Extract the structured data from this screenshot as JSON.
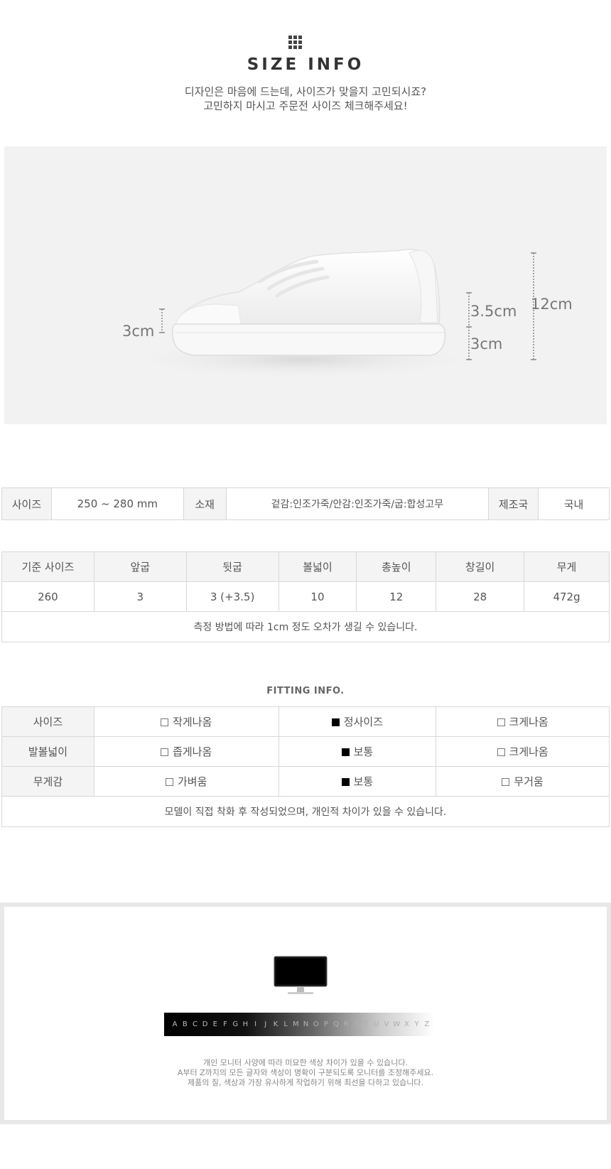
{
  "header": {
    "grid_icon": "grid-icon",
    "title": "SIZE INFO",
    "subtitle_line1": "디자인은 마음에 드는데, 사이즈가 맞을지 고민되시죠?",
    "subtitle_line2": "고민하지 마시고 주문전 사이즈 체크해주세요!"
  },
  "photo": {
    "dim_front": "3cm",
    "dim_insole": "3.5cm",
    "dim_heel": "3cm",
    "dim_total": "12cm"
  },
  "info_table": {
    "size_label": "사이즈",
    "size_value": "250 ~ 280 mm",
    "material_label": "소재",
    "material_value": "겉감:인조가죽/안감:인조가죽/굽:합성고무",
    "origin_label": "제조국",
    "origin_value": "국내"
  },
  "spec_table": {
    "headers": [
      "기준 사이즈",
      "앞굽",
      "뒷굽",
      "볼넓이",
      "총높이",
      "창길이",
      "무게"
    ],
    "values": [
      "260",
      "3",
      "3 (+3.5)",
      "10",
      "12",
      "28",
      "472g"
    ],
    "note": "측정 방법에 따라 1cm 정도 오차가 생길 수 있습니다."
  },
  "fitting": {
    "title": "FITTING INFO.",
    "rows": [
      {
        "label": "사이즈",
        "opt1": "작게나옴",
        "opt2": "정사이즈",
        "opt3": "크게나옴",
        "selected": 2
      },
      {
        "label": "발볼넓이",
        "opt1": "좁게나옴",
        "opt2": "보통",
        "opt3": "크게나옴",
        "selected": 2
      },
      {
        "label": "무게감",
        "opt1": "가벼움",
        "opt2": "보통",
        "opt3": "무거움",
        "selected": 2
      }
    ],
    "note": "모델이 직접 착화 후 작성되었으며, 개인적 차이가 있을 수 있습니다."
  },
  "notice": {
    "monitor_icon": "monitor-icon",
    "letters": [
      "A",
      "B",
      "C",
      "D",
      "E",
      "F",
      "G",
      "H",
      "I",
      "J",
      "K",
      "L",
      "M",
      "N",
      "O",
      "P",
      "Q",
      "R",
      "S",
      "T",
      "U",
      "V",
      "W",
      "X",
      "Y",
      "Z"
    ],
    "line1": "개인 모니터 사양에 따라 미묘한 색상 차이가 있을 수 있습니다.",
    "line2": "A부터 Z까지의 모든 글자와 색상이 명확이 구분되도록 모니터를 조정해주세요.",
    "line3": "제품의 질, 색상과 가장 유사하게 작업하기 위해 최선을 다하고 있습니다."
  }
}
